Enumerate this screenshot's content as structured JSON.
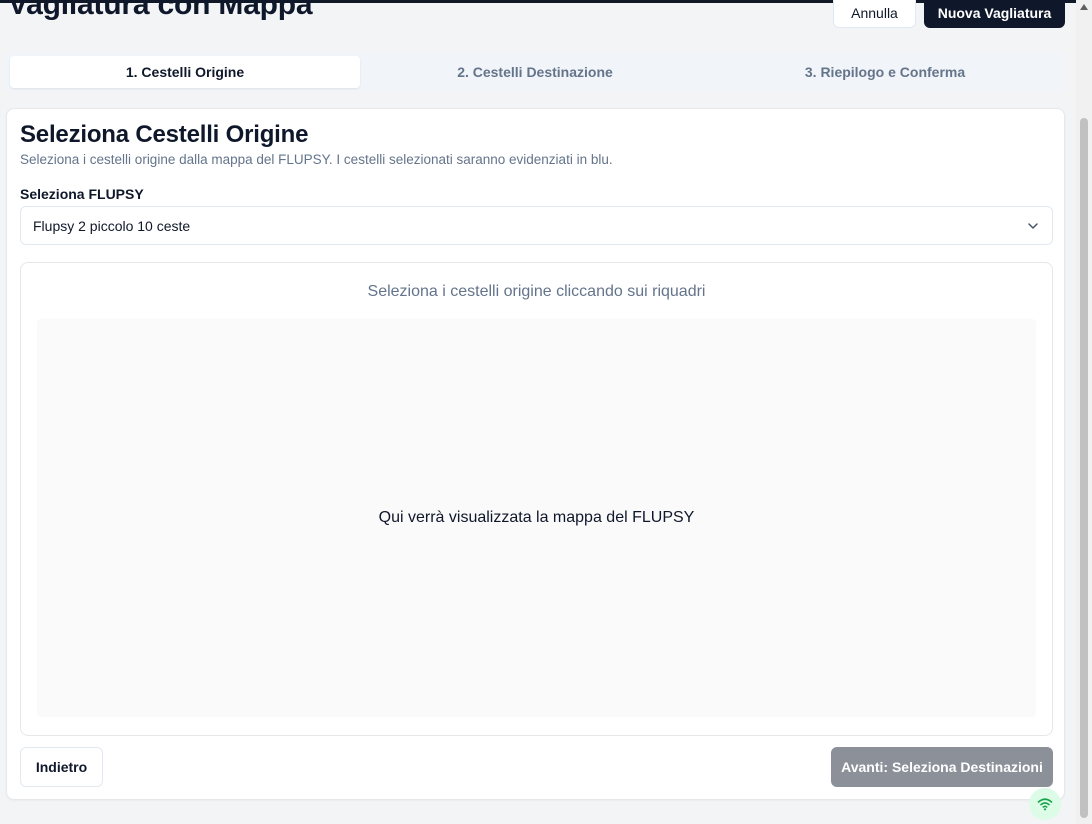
{
  "header": {
    "title": "Vagliatura con Mappa",
    "cancel_label": "Annulla",
    "new_label": "Nuova Vagliatura"
  },
  "tabs": [
    {
      "label": "1. Cestelli Origine",
      "active": true
    },
    {
      "label": "2. Cestelli Destinazione",
      "active": false
    },
    {
      "label": "3. Riepilogo e Conferma",
      "active": false
    }
  ],
  "card": {
    "title": "Seleziona Cestelli Origine",
    "description": "Seleziona i cestelli origine dalla mappa del FLUPSY. I cestelli selezionati saranno evidenziati in blu.",
    "flupsy_label": "Seleziona FLUPSY",
    "flupsy_selected": "Flupsy 2 piccolo 10 ceste",
    "map_hint": "Seleziona i cestelli origine cliccando sui riquadri",
    "map_placeholder": "Qui verrà visualizzata la mappa del FLUPSY",
    "back_label": "Indietro",
    "next_label": "Avanti: Seleziona Destinazioni"
  },
  "colors": {
    "primary": "#0f172a",
    "disabled_button": "#8b9099",
    "connection_badge": "#dcfce7",
    "connection_icon": "#16a34a"
  },
  "icons": {
    "select": "chevron-down-icon",
    "connection": "wifi-icon"
  }
}
